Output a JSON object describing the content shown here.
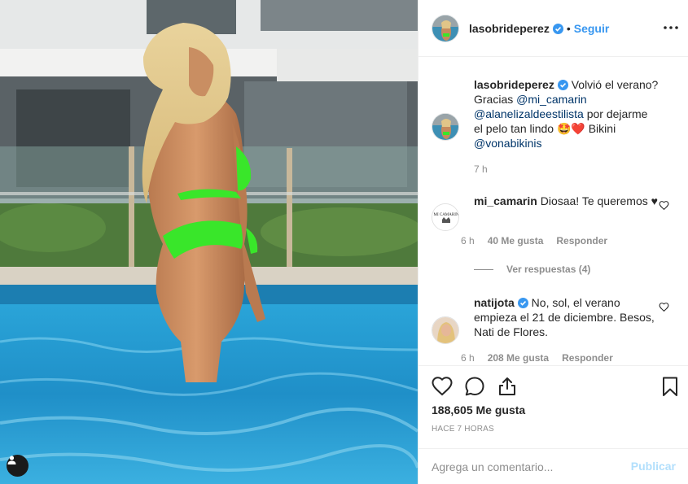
{
  "post_author": {
    "username": "lasobrideperez",
    "verified": true,
    "separator": "•",
    "follow_label": "Seguir"
  },
  "caption": {
    "username": "lasobrideperez",
    "text_1": "Volvió el verano? Gracias ",
    "mention_1": "@mi_camarin",
    "mention_2": "@alanelizaldeestilista",
    "text_2": " por dejarme el pelo tan lindo 🤩❤️ Bikini ",
    "mention_3": "@vonabikinis",
    "time": "7 h"
  },
  "comments": [
    {
      "username": "mi_camarin",
      "text": "Diosaa! Te queremos ♥",
      "time": "6 h",
      "likes": "40 Me gusta",
      "reply_label": "Responder",
      "avatar_text": "MI CAMARIN"
    },
    {
      "username": "natijota",
      "verified": true,
      "text": "No, sol, el verano empieza el 21 de diciembre. Besos, Nati de Flores.",
      "time": "6 h",
      "likes": "208 Me gusta",
      "reply_label": "Responder"
    }
  ],
  "view_replies": "Ver respuestas (4)",
  "actions": {
    "likes_count": "188,605 Me gusta",
    "date": "HACE 7 HORAS"
  },
  "add_comment": {
    "placeholder": "Agrega un comentario...",
    "post_label": "Publicar"
  },
  "colors": {
    "accent": "#3897f0",
    "link": "#003569",
    "muted": "#8e8e8e",
    "post_disabled": "#b2dffc",
    "bikini": "#39e62a",
    "pool": "#2a9fd6"
  },
  "icons": [
    "verified-icon",
    "more-options-icon",
    "heart-icon",
    "comment-icon",
    "share-icon",
    "bookmark-icon",
    "user-tag-icon"
  ]
}
